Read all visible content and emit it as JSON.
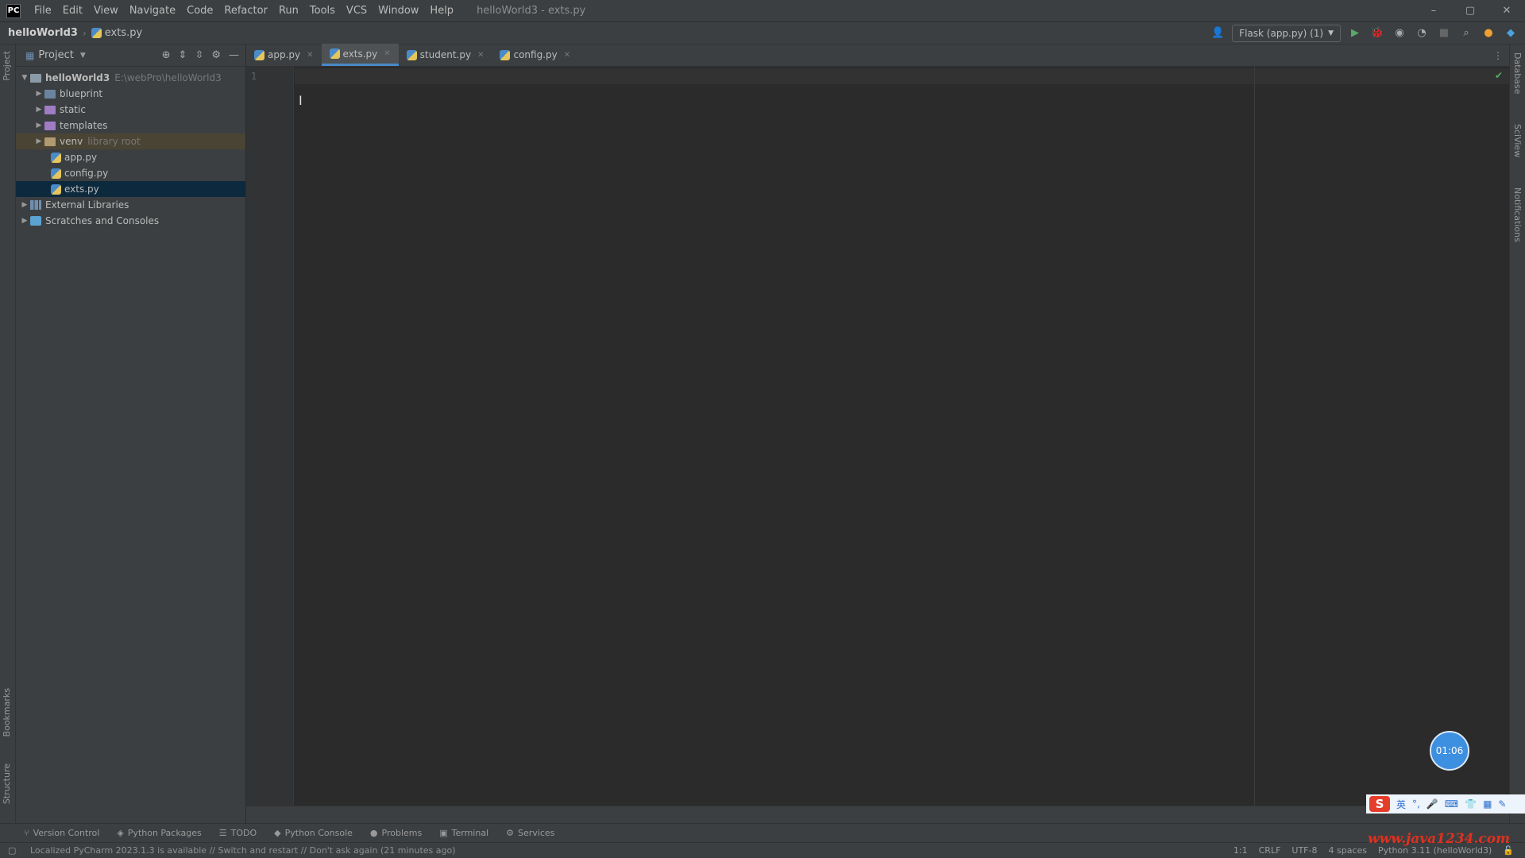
{
  "window": {
    "title": "helloWorld3 - exts.py",
    "minimize": "–",
    "maximize": "▢",
    "close": "✕"
  },
  "menu": [
    "File",
    "Edit",
    "View",
    "Navigate",
    "Code",
    "Refactor",
    "Run",
    "Tools",
    "VCS",
    "Window",
    "Help"
  ],
  "breadcrumb": {
    "project": "helloWorld3",
    "file": "exts.py"
  },
  "run_config": {
    "label": "Flask (app.py) (1)"
  },
  "project_panel": {
    "title": "Project",
    "tree": {
      "root": {
        "name": "helloWorld3",
        "path": "E:\\webPro\\helloWorld3"
      },
      "folders": [
        {
          "name": "blueprint"
        },
        {
          "name": "static"
        },
        {
          "name": "templates"
        },
        {
          "name": "venv",
          "hint": "library root"
        }
      ],
      "files": [
        "app.py",
        "config.py",
        "exts.py"
      ],
      "external_libraries": "External Libraries",
      "scratches": "Scratches and Consoles"
    }
  },
  "tabs": [
    {
      "label": "app.py",
      "active": false
    },
    {
      "label": "exts.py",
      "active": true
    },
    {
      "label": "student.py",
      "active": false
    },
    {
      "label": "config.py",
      "active": false
    }
  ],
  "editor": {
    "line_number": "1",
    "caret": "I"
  },
  "left_strip": {
    "project": "Project",
    "bookmarks": "Bookmarks",
    "structure": "Structure"
  },
  "right_strip": {
    "database": "Database",
    "sciview": "SciView",
    "notifications": "Notifications"
  },
  "tool_windows": [
    "Version Control",
    "Python Packages",
    "TODO",
    "Python Console",
    "Problems",
    "Terminal",
    "Services"
  ],
  "status": {
    "message": "Localized PyCharm 2023.1.3 is available // Switch and restart // Don't ask again (21 minutes ago)",
    "position": "1:1",
    "line_sep": "CRLF",
    "encoding": "UTF-8",
    "indent": "4 spaces",
    "interpreter": "Python 3.11 (helloWorld3)"
  },
  "overlay": {
    "timer": "01:06",
    "ime_logo": "S",
    "ime_lang": "英",
    "watermark": "www.java1234.com"
  }
}
